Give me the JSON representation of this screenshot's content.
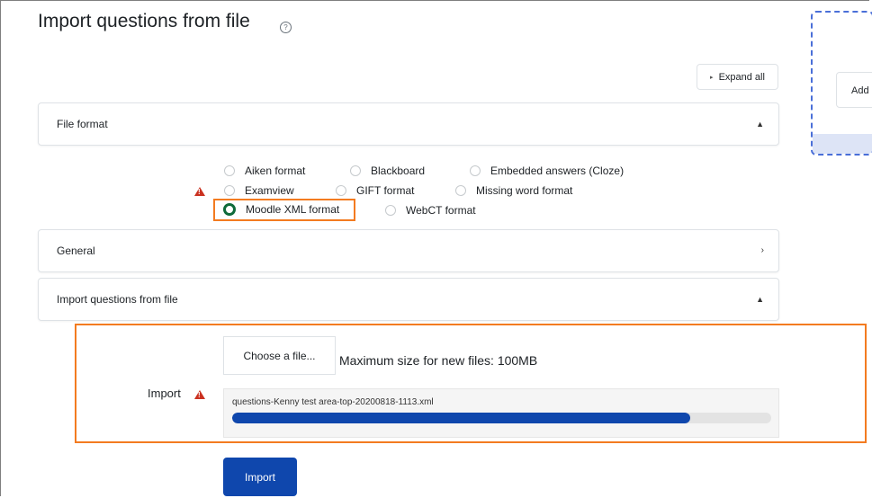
{
  "page": {
    "title": "Import questions from file",
    "expand_all": "Expand all"
  },
  "sections": {
    "file_format": "File format",
    "general": "General",
    "import_from_file": "Import questions from file"
  },
  "formats": {
    "aiken": "Aiken format",
    "blackboard": "Blackboard",
    "cloze": "Embedded answers (Cloze)",
    "examview": "Examview",
    "gift": "GIFT format",
    "missing_word": "Missing word format",
    "moodle_xml": "Moodle XML format",
    "webct": "WebCT format",
    "selected": "Moodle XML format"
  },
  "upload": {
    "choose_label": "Choose a file...",
    "max_size": "Maximum size for new files: 100MB",
    "import_label": "Import",
    "filename": "questions-Kenny test area-top-20200818-1113.xml",
    "progress_fraction": 0.85
  },
  "buttons": {
    "import": "Import"
  },
  "side_panel": {
    "add_label": "Add"
  },
  "colors": {
    "primary": "#0f47ad",
    "highlight": "#f37b20",
    "radio_selected": "#0f6b3a",
    "warning": "#ca3120"
  },
  "icons": {
    "help": "question-circle-icon",
    "warning": "warning-triangle-icon",
    "expand": "chevron-right-icon",
    "collapse": "chevron-up-icon"
  }
}
